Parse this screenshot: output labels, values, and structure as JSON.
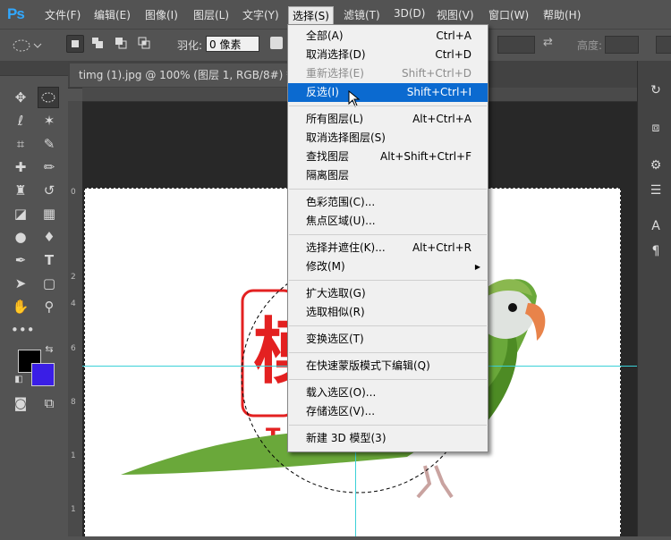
{
  "app": {
    "logo": "Ps"
  },
  "menubar": {
    "items": [
      {
        "label": "文件(F)"
      },
      {
        "label": "编辑(E)"
      },
      {
        "label": "图像(I)"
      },
      {
        "label": "图层(L)"
      },
      {
        "label": "文字(Y)"
      },
      {
        "label": "选择(S)"
      },
      {
        "label": "滤镜(T)"
      },
      {
        "label": "3D(D)"
      },
      {
        "label": "视图(V)"
      },
      {
        "label": "窗口(W)"
      },
      {
        "label": "帮助(H)"
      }
    ],
    "active": "选择(S)"
  },
  "options": {
    "feather_label": "羽化:",
    "feather_value": "0 像素",
    "height_label": "高度:"
  },
  "document": {
    "tab_title": "timg (1).jpg @ 100% (图层 1, RGB/8#) *",
    "close_glyph": "×",
    "ruler_left": [
      "0",
      "2",
      "4",
      "6",
      "8",
      "1",
      "1"
    ]
  },
  "colors": {
    "foreground": "#000000",
    "background": "#3a1ee6",
    "guide": "#3bd1d8",
    "highlight": "#0b6ad0"
  },
  "select_menu": {
    "items": [
      {
        "label": "全部(A)",
        "shortcut": "Ctrl+A",
        "disabled": false
      },
      {
        "label": "取消选择(D)",
        "shortcut": "Ctrl+D",
        "disabled": false
      },
      {
        "label": "重新选择(E)",
        "shortcut": "Shift+Ctrl+D",
        "disabled": true
      },
      {
        "label": "反选(I)",
        "shortcut": "Shift+Ctrl+I",
        "highlighted": true
      },
      {
        "label": "所有图层(L)",
        "shortcut": "Alt+Ctrl+A"
      },
      {
        "label": "取消选择图层(S)",
        "shortcut": ""
      },
      {
        "label": "查找图层",
        "shortcut": "Alt+Shift+Ctrl+F"
      },
      {
        "label": "隔离图层",
        "shortcut": ""
      },
      {
        "label": "色彩范围(C)...",
        "shortcut": ""
      },
      {
        "label": "焦点区域(U)...",
        "shortcut": ""
      },
      {
        "label": "选择并遮住(K)...",
        "shortcut": "Alt+Ctrl+R"
      },
      {
        "label": "修改(M)",
        "shortcut": "",
        "submenu": true
      },
      {
        "label": "扩大选取(G)",
        "shortcut": ""
      },
      {
        "label": "选取相似(R)",
        "shortcut": ""
      },
      {
        "label": "变换选区(T)",
        "shortcut": ""
      },
      {
        "label": "在快速蒙版模式下编辑(Q)",
        "shortcut": ""
      },
      {
        "label": "载入选区(O)...",
        "shortcut": ""
      },
      {
        "label": "存储选区(V)...",
        "shortcut": ""
      },
      {
        "label": "新建 3D 模型(3)",
        "shortcut": ""
      }
    ]
  },
  "canvas_image": {
    "stamp_text": "T",
    "stamp_char": "模"
  },
  "icons": {
    "tools": [
      "move-icon",
      "marquee-ellipse-icon",
      "lasso-icon",
      "magic-wand-icon",
      "crop-icon",
      "eyedropper-icon",
      "healing-brush-icon",
      "brush-icon",
      "clone-stamp-icon",
      "history-brush-icon",
      "eraser-icon",
      "gradient-icon",
      "blur-icon",
      "dodge-icon",
      "pen-icon",
      "type-icon",
      "path-select-icon",
      "shape-icon",
      "hand-icon",
      "zoom-icon",
      "more-tools-icon"
    ],
    "right_panel": [
      "history-panel-icon",
      "actions-panel-icon",
      "adjustments-panel-icon",
      "properties-panel-icon",
      "character-panel-icon",
      "paragraph-panel-icon"
    ]
  }
}
